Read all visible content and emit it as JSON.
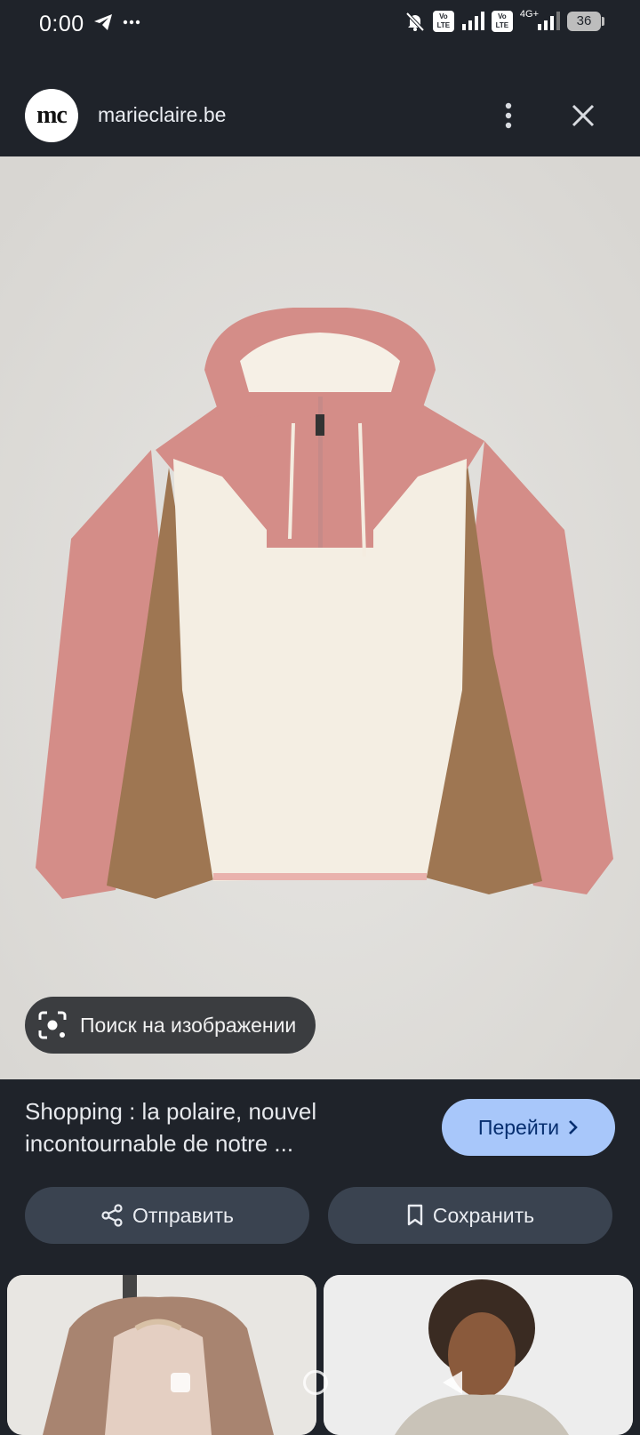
{
  "status_bar": {
    "time": "0:00",
    "lte1": "Vo LTE",
    "lte2": "Vo LTE",
    "network": "4G+",
    "battery": "36"
  },
  "header": {
    "logo_text": "mc",
    "site_name": "marieclaire.be"
  },
  "image": {
    "lens_label": "Поиск на изображении"
  },
  "result": {
    "title": "Shopping : la polaire, nouvel incontournable de notre ...",
    "go_label": "Перейти"
  },
  "actions": {
    "share_label": "Отправить",
    "save_label": "Сохранить"
  },
  "colors": {
    "background": "#1f232a",
    "go_button": "#a8c7fa",
    "action_button": "#3a4350",
    "jacket_pink": "#d48d88",
    "jacket_cream": "#f4eee3",
    "jacket_brown": "#9e7652"
  }
}
